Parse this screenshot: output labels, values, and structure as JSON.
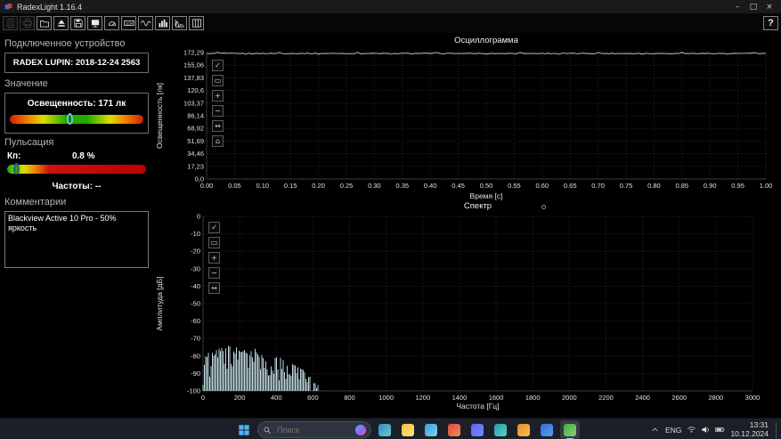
{
  "window": {
    "title": "RadexLight 1.16.4"
  },
  "titlebar": {
    "minimize": "–",
    "maximize": "□",
    "close": "×"
  },
  "toolbar": {
    "help_label": "?",
    "buttons": [
      {
        "name": "report-button",
        "icon": "report-icon",
        "enabled": false
      },
      {
        "name": "print-button",
        "icon": "printer-icon",
        "enabled": false
      },
      {
        "name": "open-button",
        "icon": "folder-icon",
        "enabled": true
      },
      {
        "name": "start-measurement-button",
        "icon": "eject-icon",
        "enabled": true
      },
      {
        "name": "save-button",
        "icon": "save-icon",
        "enabled": true
      },
      {
        "name": "display-button",
        "icon": "display-icon",
        "enabled": true
      },
      {
        "name": "meter-button",
        "icon": "meter-icon",
        "enabled": true
      },
      {
        "name": "clock-button",
        "icon": "clock-icon",
        "enabled": true
      },
      {
        "name": "oscillogram-button",
        "icon": "wave-icon",
        "enabled": true
      },
      {
        "name": "histogram-button",
        "icon": "histogram-icon",
        "enabled": true
      },
      {
        "name": "spectrum-button",
        "icon": "spectrum-icon",
        "enabled": true
      },
      {
        "name": "layout-button",
        "icon": "layout-icon",
        "enabled": true
      }
    ]
  },
  "sidebar": {
    "device": {
      "title": "Подключенное устройство",
      "value": "RADEX LUPIN: 2018-12-24 2563"
    },
    "value": {
      "title": "Значение",
      "label": "Освещенность: 171 лк",
      "marker_pct": 45
    },
    "pulsation": {
      "title": "Пульсация",
      "kp_label": "Кп:",
      "kp_value": "0.8 %",
      "freq_label": "Частоты: --",
      "marker_pct": 7
    },
    "comments": {
      "title": "Комментарии",
      "text": "Blackview Active 10 Pro - 50% яркость"
    }
  },
  "chart_tools": {
    "osc": [
      {
        "name": "osc-select-button",
        "glyph": "✓"
      },
      {
        "name": "osc-zoom-box-button",
        "glyph": "▭"
      },
      {
        "name": "osc-zoom-in-button",
        "glyph": "+"
      },
      {
        "name": "osc-zoom-out-button",
        "glyph": "−"
      },
      {
        "name": "osc-pan-button",
        "glyph": "↔"
      },
      {
        "name": "osc-reset-button",
        "glyph": "⌂"
      }
    ],
    "spec": [
      {
        "name": "spec-select-button",
        "glyph": "✓"
      },
      {
        "name": "spec-zoom-box-button",
        "glyph": "▭"
      },
      {
        "name": "spec-zoom-in-button",
        "glyph": "+"
      },
      {
        "name": "spec-zoom-out-button",
        "glyph": "−"
      },
      {
        "name": "spec-pan-button",
        "glyph": "↔"
      }
    ]
  },
  "chart_data": [
    {
      "type": "line",
      "title": "Осциллограмма",
      "xlabel": "Время [с]",
      "ylabel": "Освещенность [лк]",
      "xlim": [
        0,
        1
      ],
      "ylim": [
        0,
        172.29
      ],
      "grid": true,
      "legend": "none",
      "line_color": "#cfeaf2",
      "xticks": [
        "0.00",
        "0.05",
        "0.10",
        "0.15",
        "0.20",
        "0.25",
        "0.30",
        "0.35",
        "0.40",
        "0.45",
        "0.50",
        "0.55",
        "0.60",
        "0.65",
        "0.70",
        "0.75",
        "0.80",
        "0.85",
        "0.90",
        "0.95",
        "1.00"
      ],
      "yticks": [
        "172,29",
        "155,06",
        "137,83",
        "120,6",
        "103,37",
        "86,14",
        "68,92",
        "51,69",
        "34,46",
        "17,23",
        "0,0"
      ],
      "series": [
        {
          "name": "Освещенность",
          "baseline": 171,
          "noise_amplitude": 0.4,
          "x_step": 0.005,
          "spikes": [
            [
              0.02,
              172.6
            ],
            [
              0.07,
              169.8
            ],
            [
              0.13,
              172.5
            ],
            [
              0.2,
              170.0
            ],
            [
              0.27,
              172.7
            ],
            [
              0.33,
              169.9
            ],
            [
              0.41,
              172.5
            ],
            [
              0.5,
              170.1
            ],
            [
              0.56,
              172.6
            ],
            [
              0.63,
              169.8
            ],
            [
              0.7,
              172.4
            ],
            [
              0.78,
              170.0
            ],
            [
              0.85,
              172.6
            ],
            [
              0.93,
              169.9
            ],
            [
              0.98,
              172.3
            ]
          ]
        }
      ]
    },
    {
      "type": "area",
      "title": "Спектр",
      "xlabel": "Частота [Гц]",
      "ylabel": "Амплитуда [дБ]",
      "xlim": [
        0,
        3000
      ],
      "ylim": [
        -100,
        0
      ],
      "grid": true,
      "legend": "none",
      "line_color": "#cfeaf2",
      "noise_floor": -100,
      "xticks": [
        "0",
        "200",
        "400",
        "600",
        "800",
        "1000",
        "1200",
        "1400",
        "1600",
        "1800",
        "2000",
        "2200",
        "2400",
        "2600",
        "2800",
        "3000"
      ],
      "yticks": [
        "0",
        "-10",
        "-20",
        "-30",
        "-40",
        "-50",
        "-60",
        "-70",
        "-80",
        "-90",
        "-100"
      ],
      "envelope_db": [
        [
          0,
          -84
        ],
        [
          25,
          -80
        ],
        [
          50,
          -78
        ],
        [
          100,
          -75
        ],
        [
          150,
          -76
        ],
        [
          200,
          -77
        ],
        [
          250,
          -76
        ],
        [
          300,
          -78
        ],
        [
          350,
          -79
        ],
        [
          400,
          -80
        ],
        [
          450,
          -82
        ],
        [
          500,
          -85
        ],
        [
          550,
          -88
        ],
        [
          600,
          -93
        ],
        [
          630,
          -97
        ],
        [
          650,
          -100
        ]
      ]
    }
  ],
  "taskbar": {
    "start_icon": "windows-icon",
    "search_placeholder": "Поиск",
    "search_icon": "search-icon",
    "apps": [
      {
        "name": "edge",
        "color": "#2f86d8",
        "color2": "#66d0b8"
      },
      {
        "name": "file-explorer",
        "color": "#f5c33b",
        "color2": "#ffe08a"
      },
      {
        "name": "telegram",
        "color": "#2ea6da",
        "color2": "#7fd0f0"
      },
      {
        "name": "app-red",
        "color": "#d94a3d",
        "color2": "#f08a5a"
      },
      {
        "name": "discord",
        "color": "#5865f2",
        "color2": "#7a86ff"
      },
      {
        "name": "app-teal",
        "color": "#1f9e9e",
        "color2": "#5fd0c8"
      },
      {
        "name": "browser-orange",
        "color": "#e8872f",
        "color2": "#f6c24a"
      },
      {
        "name": "outlook",
        "color": "#2b6fd4",
        "color2": "#5aa0f0"
      },
      {
        "name": "radexlight",
        "color": "#3fae4e",
        "color2": "#8ad06a",
        "active": true
      }
    ],
    "tray": {
      "chevron_icon": "chevron-up-icon",
      "status_icons": [
        {
          "name": "wifi",
          "icon": "wifi-icon"
        },
        {
          "name": "volume",
          "icon": "volume-icon"
        },
        {
          "name": "battery",
          "icon": "battery-icon"
        }
      ],
      "lang": "ENG",
      "time": "13:31",
      "date": "10.12.2024"
    }
  }
}
